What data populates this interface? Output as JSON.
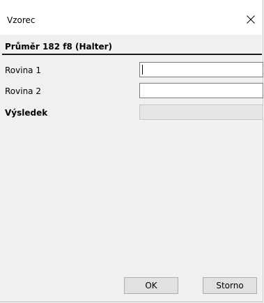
{
  "window": {
    "title": "Vzorec",
    "close_icon": "close-icon"
  },
  "form": {
    "heading": "Průměr 182 f8 (Halter)",
    "rows": [
      {
        "label": "Rovina 1",
        "value": ""
      },
      {
        "label": "Rovina 2",
        "value": ""
      },
      {
        "label": "Výsledek",
        "value": ""
      }
    ]
  },
  "buttons": {
    "ok": "OK",
    "cancel": "Storno"
  }
}
